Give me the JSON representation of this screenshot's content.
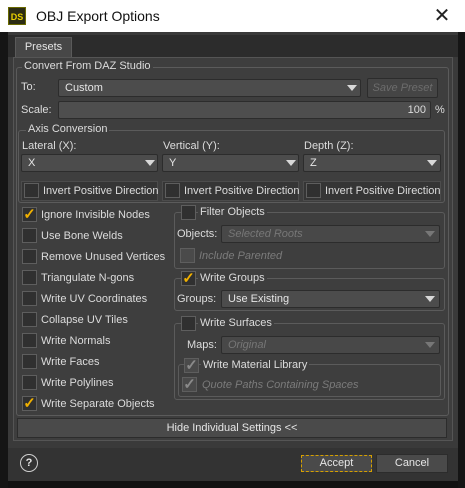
{
  "window": {
    "icon_text": "DS",
    "title": "OBJ Export Options",
    "close": "✕"
  },
  "tabs": [
    {
      "label": "Presets"
    }
  ],
  "convert": {
    "group_label": "Convert From DAZ Studio",
    "to_label": "To:",
    "to_value": "Custom",
    "save_preset": "Save Preset",
    "scale_label": "Scale:",
    "scale_value": "100",
    "scale_unit": "%"
  },
  "axis": {
    "group_label": "Axis Conversion",
    "lateral_label": "Lateral (X):",
    "lateral_value": "X",
    "vertical_label": "Vertical (Y):",
    "vertical_value": "Y",
    "depth_label": "Depth (Z):",
    "depth_value": "Z",
    "invert_label": "Invert Positive Direction"
  },
  "options": [
    {
      "label": "Ignore Invisible Nodes",
      "checked": true
    },
    {
      "label": "Use Bone Welds",
      "checked": false
    },
    {
      "label": "Remove Unused Vertices",
      "checked": false
    },
    {
      "label": "Triangulate N-gons",
      "checked": false
    },
    {
      "label": "Write UV Coordinates",
      "checked": false
    },
    {
      "label": "Collapse UV Tiles",
      "checked": false
    },
    {
      "label": "Write Normals",
      "checked": false
    },
    {
      "label": "Write Faces",
      "checked": false
    },
    {
      "label": "Write Polylines",
      "checked": false
    },
    {
      "label": "Write Separate Objects",
      "checked": true
    }
  ],
  "filter": {
    "label": "Filter Objects",
    "objects_label": "Objects:",
    "objects_value": "Selected Roots",
    "include_parented": "Include Parented"
  },
  "groups": {
    "label": "Write Groups",
    "groups_label": "Groups:",
    "groups_value": "Use Existing"
  },
  "surfaces": {
    "label": "Write Surfaces",
    "maps_label": "Maps:",
    "maps_value": "Original",
    "material_library": "Write Material Library",
    "quote_paths": "Quote Paths Containing Spaces"
  },
  "hide_settings": "Hide Individual Settings <<",
  "footer": {
    "help": "?",
    "accept": "Accept",
    "cancel": "Cancel"
  },
  "colors": {
    "accent_check": "#f0b000",
    "accept_focus": "#d6a000"
  }
}
